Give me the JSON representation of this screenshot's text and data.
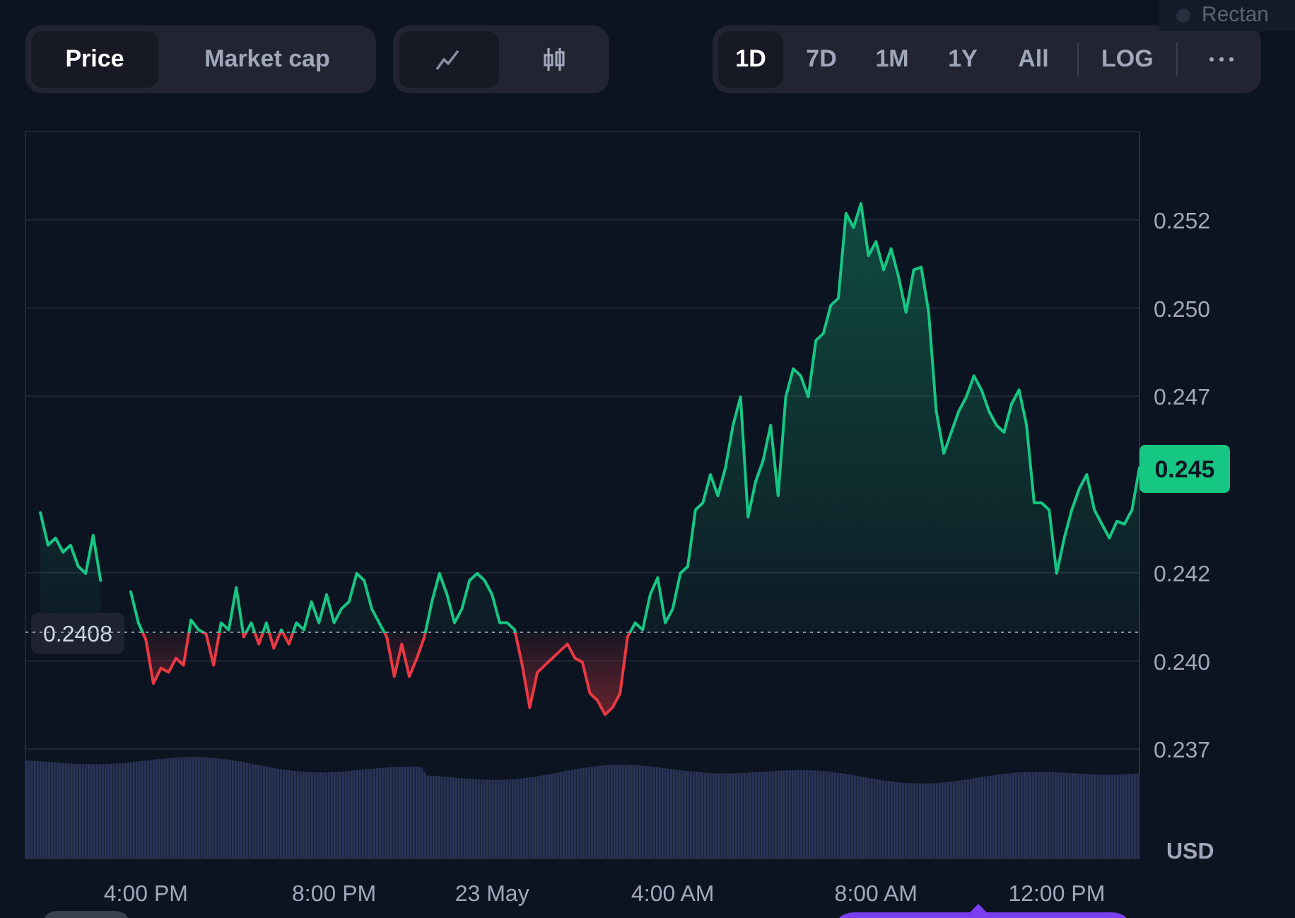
{
  "overlay_label": "Rectan",
  "range_tabs": [
    {
      "label": "Price",
      "selected": true
    },
    {
      "label": "Market cap",
      "selected": false
    }
  ],
  "chart_types": [
    {
      "kind": "line",
      "selected": true
    },
    {
      "kind": "candles",
      "selected": false
    }
  ],
  "timeframes": [
    {
      "label": "1D",
      "selected": true
    },
    {
      "label": "7D",
      "selected": false
    },
    {
      "label": "1M",
      "selected": false
    },
    {
      "label": "1Y",
      "selected": false
    },
    {
      "label": "All",
      "selected": false
    }
  ],
  "scale_button": {
    "label": "LOG"
  },
  "chart": {
    "currency": "USD",
    "baseline_label": "0.2408",
    "price_tag": "0.245",
    "chart_data": {
      "type": "area",
      "grid": true,
      "categories": [
        null,
        null,
        null,
        null,
        null,
        null,
        null,
        null,
        null,
        null,
        null,
        null,
        null,
        null,
        null,
        null,
        "4:00 PM",
        null,
        null,
        null,
        null,
        null,
        null,
        null,
        null,
        null,
        null,
        null,
        null,
        null,
        null,
        null,
        null,
        null,
        null,
        null,
        null,
        null,
        null,
        null,
        null,
        "8:00 PM",
        null,
        null,
        null,
        null,
        null,
        null,
        null,
        null,
        null,
        null,
        null,
        null,
        null,
        null,
        null,
        null,
        null,
        null,
        null,
        null,
        "23 May",
        null,
        null,
        null,
        null,
        null,
        null,
        null,
        null,
        null,
        null,
        null,
        null,
        null,
        null,
        null,
        null,
        null,
        null,
        null,
        null,
        null,
        null,
        null,
        "4:00 AM",
        null,
        null,
        null,
        null,
        null,
        null,
        null,
        null,
        null,
        null,
        null,
        null,
        null,
        null,
        null,
        null,
        null,
        null,
        null,
        null,
        null,
        null,
        null,
        null,
        null,
        null,
        "8:00 AM",
        null,
        null,
        null,
        null,
        null,
        null,
        null,
        null,
        null,
        null,
        null,
        null,
        null,
        null,
        null,
        null,
        null,
        null,
        null,
        null,
        null,
        null,
        null,
        "12:00 PM",
        null,
        null,
        null,
        null,
        null,
        null,
        null,
        null,
        null,
        null,
        null
      ],
      "series": [
        {
          "color": "#16c784",
          "values": [
            null,
            null,
            0.2442,
            0.24328,
            0.24348,
            0.24308,
            0.24328,
            0.24268,
            0.24248,
            0.24356,
            0.24228,
            null,
            null,
            null,
            0.24196,
            0.24108,
            0.2406,
            0.23936,
            0.2398,
            0.23968,
            0.24008,
            0.23988,
            0.24116,
            0.24088,
            0.24076,
            0.23988,
            0.24108,
            0.24088,
            0.24208,
            0.24068,
            0.24108,
            0.24048,
            0.24108,
            0.24036,
            0.24088,
            0.24048,
            0.24108,
            0.24088,
            0.24168,
            0.24108,
            0.24188,
            0.24108,
            0.24148,
            0.24168,
            0.24248,
            0.24228,
            0.24148,
            0.24108,
            0.24068,
            0.23956,
            0.24048,
            0.23956,
            0.24008,
            0.24068,
            0.24168,
            0.24248,
            0.24188,
            0.24108,
            0.24148,
            0.24228,
            0.24248,
            0.24228,
            0.24188,
            0.24108,
            0.24108,
            0.24088,
            0.23988,
            0.23868,
            0.23968,
            0.23988,
            0.24008,
            0.24028,
            0.24048,
            0.24008,
            0.23996,
            0.23908,
            0.23888,
            0.23848,
            0.23868,
            0.23908,
            0.24068,
            0.24108,
            0.24088,
            0.24188,
            0.24236,
            0.24108,
            0.24148,
            0.24248,
            0.24268,
            0.24428,
            0.24448,
            0.24528,
            0.24468,
            0.24548,
            0.24668,
            0.24748,
            0.24408,
            0.24508,
            0.24568,
            0.24668,
            0.24468,
            0.24748,
            0.24828,
            0.24808,
            0.24748,
            0.24908,
            0.24928,
            0.25008,
            0.25028,
            0.25268,
            0.25228,
            0.25296,
            0.25148,
            0.25188,
            0.25108,
            0.25168,
            0.25088,
            0.24988,
            0.25108,
            0.25116,
            0.24988,
            0.24708,
            0.24588,
            0.24648,
            0.24708,
            0.24748,
            0.24808,
            0.24768,
            0.24708,
            0.24668,
            0.24648,
            0.24728,
            0.24768,
            0.24668,
            0.24448,
            0.24448,
            0.24428,
            0.24248,
            0.24348,
            0.24428,
            0.24488,
            0.24528,
            0.24428,
            0.24388,
            0.24348,
            0.24396,
            0.24388,
            0.24428,
            0.24548
          ]
        }
      ],
      "ylim": [
        0.2344,
        0.255
      ],
      "yticks": [
        {
          "value": 0.2525,
          "label": "0.252"
        },
        {
          "value": 0.25,
          "label": "0.250"
        },
        {
          "value": 0.2475,
          "label": "0.247"
        },
        {
          "value": 0.2425,
          "label": "0.242"
        },
        {
          "value": 0.24,
          "label": "0.240"
        },
        {
          "value": 0.2375,
          "label": "0.237"
        }
      ]
    }
  }
}
